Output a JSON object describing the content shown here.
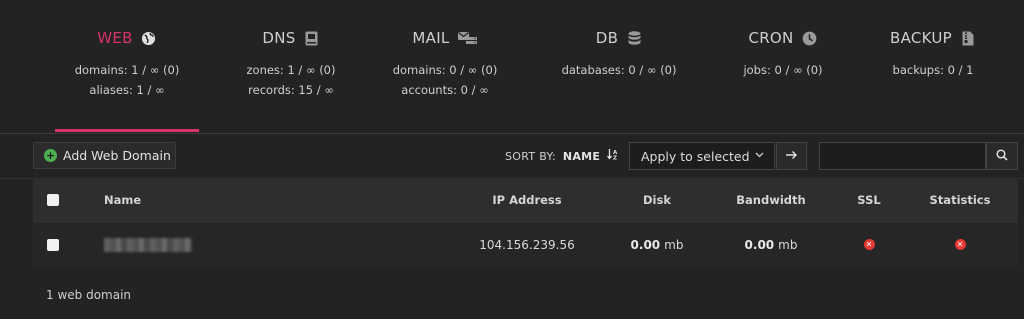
{
  "tabs": [
    {
      "label": "WEB",
      "icon": "globe-icon",
      "stat1": "domains: 1 / ∞ (0)",
      "stat2": "aliases: 1 / ∞",
      "active": true
    },
    {
      "label": "DNS",
      "icon": "book-icon",
      "stat1": "zones: 1 / ∞ (0)",
      "stat2": "records: 15 / ∞"
    },
    {
      "label": "MAIL",
      "icon": "mail-server-icon",
      "stat1": "domains: 0 / ∞ (0)",
      "stat2": "accounts: 0 / ∞"
    },
    {
      "label": "DB",
      "icon": "database-icon",
      "stat1": "databases: 0 / ∞ (0)",
      "stat2": ""
    },
    {
      "label": "CRON",
      "icon": "clock-icon",
      "stat1": "jobs: 0 / ∞ (0)",
      "stat2": ""
    },
    {
      "label": "BACKUP",
      "icon": "file-archive-icon",
      "stat1": "backups: 0 / 1",
      "stat2": ""
    }
  ],
  "toolbar": {
    "add_label": "Add Web Domain",
    "sort_prefix": "SORT BY:",
    "sort_field": "NAME",
    "apply_label": "Apply to selected",
    "search_placeholder": ""
  },
  "table": {
    "headers": {
      "name": "Name",
      "ip": "IP Address",
      "disk": "Disk",
      "bandwidth": "Bandwidth",
      "ssl": "SSL",
      "stats": "Statistics"
    },
    "rows": [
      {
        "ip": "104.156.239.56",
        "disk_value": "0.00",
        "disk_unit": "mb",
        "bw_value": "0.00",
        "bw_unit": "mb"
      }
    ]
  },
  "footer": {
    "count": "1 web domain"
  },
  "colors": {
    "accent": "#d6336c",
    "ok": "#4caf50",
    "error": "#e53935",
    "background": "#232323"
  }
}
